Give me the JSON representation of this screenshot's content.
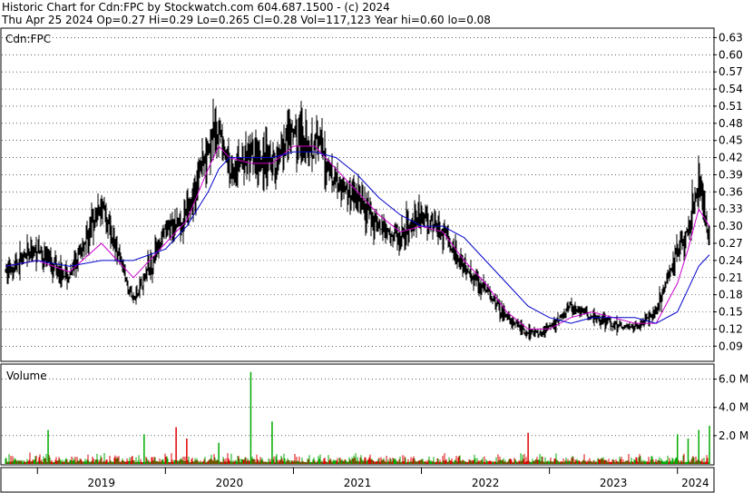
{
  "header": {
    "title": "Historic Chart for Cdn:FPC by Stockwatch.com 604.687.1500 - (c) 2024",
    "summary": "Thu Apr 25 2024   Op=0.27  Hi=0.29  Lo=0.265  Cl=0.28  Vol=117,123  Year hi=0.60  lo=0.08"
  },
  "colors": {
    "price_bars": "#000000",
    "ma_short": "#cc00cc",
    "ma_long": "#0000cc",
    "volume_up": "#00aa00",
    "volume_down": "#dd0000",
    "gridlines": "#000000"
  },
  "chart_data": [
    {
      "type": "ohlc",
      "label": "Cdn:FPC",
      "price_ticks": [
        "0.63",
        "0.60",
        "0.57",
        "0.54",
        "0.51",
        "0.48",
        "0.45",
        "0.42",
        "0.39",
        "0.36",
        "0.33",
        "0.30",
        "0.27",
        "0.24",
        "0.21",
        "0.18",
        "0.15",
        "0.12",
        "0.09"
      ],
      "ylim": [
        0.065,
        0.645
      ],
      "x_ticks": [
        "2019",
        "2020",
        "2021",
        "2022",
        "2023",
        "2024"
      ],
      "x": [
        "2018-10",
        "2019-01",
        "2019-04",
        "2019-07",
        "2019-10",
        "2020-01",
        "2020-03",
        "2020-05",
        "2020-06",
        "2020-07",
        "2020-09",
        "2020-11",
        "2021-01",
        "2021-03",
        "2021-05",
        "2021-07",
        "2021-09",
        "2021-11",
        "2022-01",
        "2022-03",
        "2022-05",
        "2022-07",
        "2022-09",
        "2022-11",
        "2023-01",
        "2023-03",
        "2023-05",
        "2023-07",
        "2023-09",
        "2023-11",
        "2024-01",
        "2024-02",
        "2024-03",
        "2024-04"
      ],
      "close": [
        0.22,
        0.26,
        0.21,
        0.34,
        0.17,
        0.29,
        0.32,
        0.44,
        0.47,
        0.4,
        0.42,
        0.41,
        0.46,
        0.45,
        0.38,
        0.35,
        0.3,
        0.28,
        0.32,
        0.29,
        0.23,
        0.19,
        0.14,
        0.11,
        0.12,
        0.16,
        0.14,
        0.13,
        0.12,
        0.15,
        0.26,
        0.29,
        0.38,
        0.28
      ],
      "series": [
        {
          "name": "",
          "style": "ma_short",
          "values": [
            0.23,
            0.24,
            0.22,
            0.27,
            0.21,
            0.27,
            0.31,
            0.4,
            0.44,
            0.42,
            0.41,
            0.41,
            0.44,
            0.44,
            0.4,
            0.36,
            0.32,
            0.29,
            0.3,
            0.29,
            0.24,
            0.2,
            0.15,
            0.12,
            0.12,
            0.14,
            0.15,
            0.14,
            0.13,
            0.13,
            0.2,
            0.26,
            0.33,
            0.3
          ]
        },
        {
          "name": "",
          "style": "ma_long",
          "values": [
            0.23,
            0.24,
            0.23,
            0.24,
            0.24,
            0.26,
            0.3,
            0.36,
            0.4,
            0.42,
            0.42,
            0.42,
            0.43,
            0.43,
            0.42,
            0.39,
            0.35,
            0.32,
            0.3,
            0.3,
            0.28,
            0.24,
            0.2,
            0.16,
            0.14,
            0.13,
            0.14,
            0.14,
            0.14,
            0.13,
            0.15,
            0.19,
            0.23,
            0.25
          ]
        }
      ]
    },
    {
      "type": "bar",
      "label": "Volume",
      "vol_ticks": [
        "6.0 M",
        "4.0 M",
        "2.0 M"
      ],
      "ylim": [
        0,
        7000000
      ],
      "spikes": [
        {
          "x": "2019-02",
          "value": 2400000,
          "dir": "up"
        },
        {
          "x": "2019-11",
          "value": 2100000,
          "dir": "up"
        },
        {
          "x": "2020-02",
          "value": 2600000,
          "dir": "down"
        },
        {
          "x": "2020-03",
          "value": 1800000,
          "dir": "down"
        },
        {
          "x": "2020-06",
          "value": 1500000,
          "dir": "up"
        },
        {
          "x": "2020-09",
          "value": 6500000,
          "dir": "up"
        },
        {
          "x": "2020-11",
          "value": 3000000,
          "dir": "up"
        },
        {
          "x": "2022-11",
          "value": 2200000,
          "dir": "down"
        },
        {
          "x": "2024-01",
          "value": 2100000,
          "dir": "up"
        },
        {
          "x": "2024-02",
          "value": 1800000,
          "dir": "up"
        },
        {
          "x": "2024-03",
          "value": 2400000,
          "dir": "up"
        },
        {
          "x": "2024-04",
          "value": 2700000,
          "dir": "up"
        }
      ]
    }
  ]
}
